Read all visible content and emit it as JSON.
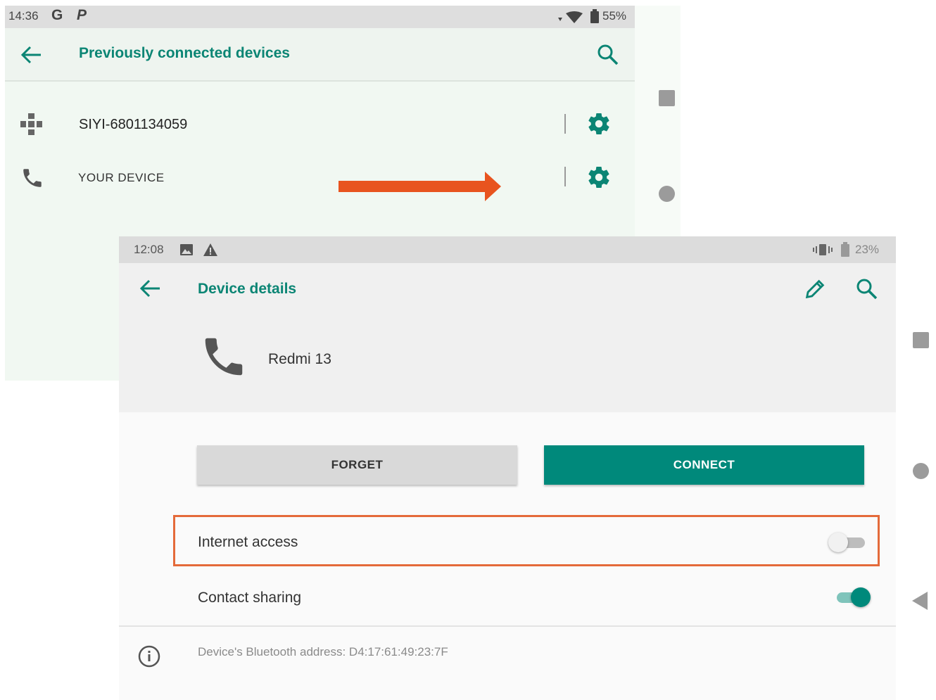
{
  "screen1": {
    "status": {
      "time": "14:36",
      "g_glyph": "G",
      "p_glyph": "P",
      "battery": "55%"
    },
    "header": {
      "title": "Previously connected devices"
    },
    "devices": [
      {
        "name": "SIYI-6801134059",
        "icon": "gamepad-icon"
      },
      {
        "name": "YOUR DEVICE",
        "icon": "phone-icon"
      }
    ],
    "arrow_color": "#e8541f"
  },
  "screen2": {
    "status": {
      "time": "12:08",
      "battery": "23%"
    },
    "header": {
      "title": "Device details",
      "device_name": "Redmi 13"
    },
    "buttons": {
      "forget": "FORGET",
      "connect": "CONNECT"
    },
    "settings": [
      {
        "label": "Internet access",
        "enabled": false
      },
      {
        "label": "Contact sharing",
        "enabled": true
      }
    ],
    "address_text": "Device's Bluetooth address: D4:17:61:49:23:7F",
    "accent_color": "#00897b",
    "highlight_color": "#e46a3a"
  }
}
